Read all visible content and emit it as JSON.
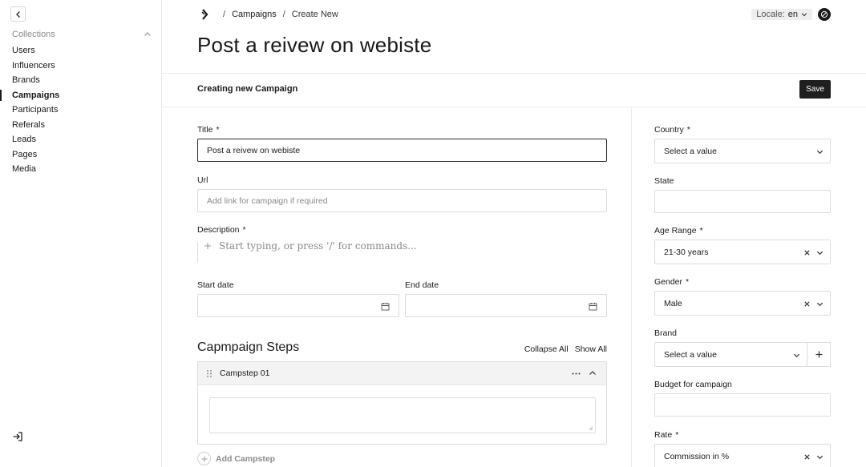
{
  "sidebar": {
    "section_label": "Collections",
    "items": [
      {
        "label": "Users",
        "active": false
      },
      {
        "label": "Influencers",
        "active": false
      },
      {
        "label": "Brands",
        "active": false
      },
      {
        "label": "Campaigns",
        "active": true
      },
      {
        "label": "Participants",
        "active": false
      },
      {
        "label": "Referals",
        "active": false
      },
      {
        "label": "Leads",
        "active": false
      },
      {
        "label": "Pages",
        "active": false
      },
      {
        "label": "Media",
        "active": false
      }
    ]
  },
  "header": {
    "breadcrumb": {
      "link": "Campaigns",
      "current": "Create New"
    },
    "locale_label": "Locale:",
    "locale_value": "en",
    "page_title": "Post a reivew on webiste"
  },
  "subheader": {
    "label": "Creating new Campaign",
    "save_label": "Save"
  },
  "form": {
    "title": {
      "label": "Title",
      "required": "*",
      "value": "Post a reivew on webiste"
    },
    "url": {
      "label": "Url",
      "placeholder": "Add link for campaign if required"
    },
    "description": {
      "label": "Description",
      "required": "*",
      "placeholder": "Start typing, or press '/' for commands..."
    },
    "start_date": {
      "label": "Start date"
    },
    "end_date": {
      "label": "End date"
    },
    "steps": {
      "title": "Capmpaign Steps",
      "collapse_all": "Collapse All",
      "show_all": "Show All",
      "items": [
        {
          "label": "Campstep 01"
        }
      ],
      "add_label": "Add Campstep"
    }
  },
  "panel": {
    "country": {
      "label": "Country",
      "required": "*",
      "value": "Select a value"
    },
    "state": {
      "label": "State"
    },
    "age_range": {
      "label": "Age Range",
      "required": "*",
      "value": "21-30 years"
    },
    "gender": {
      "label": "Gender",
      "required": "*",
      "value": "Male"
    },
    "brand": {
      "label": "Brand",
      "value": "Select a value"
    },
    "budget": {
      "label": "Budget for campaign"
    },
    "rate": {
      "label": "Rate",
      "required": "*",
      "value": "Commission in %"
    }
  }
}
